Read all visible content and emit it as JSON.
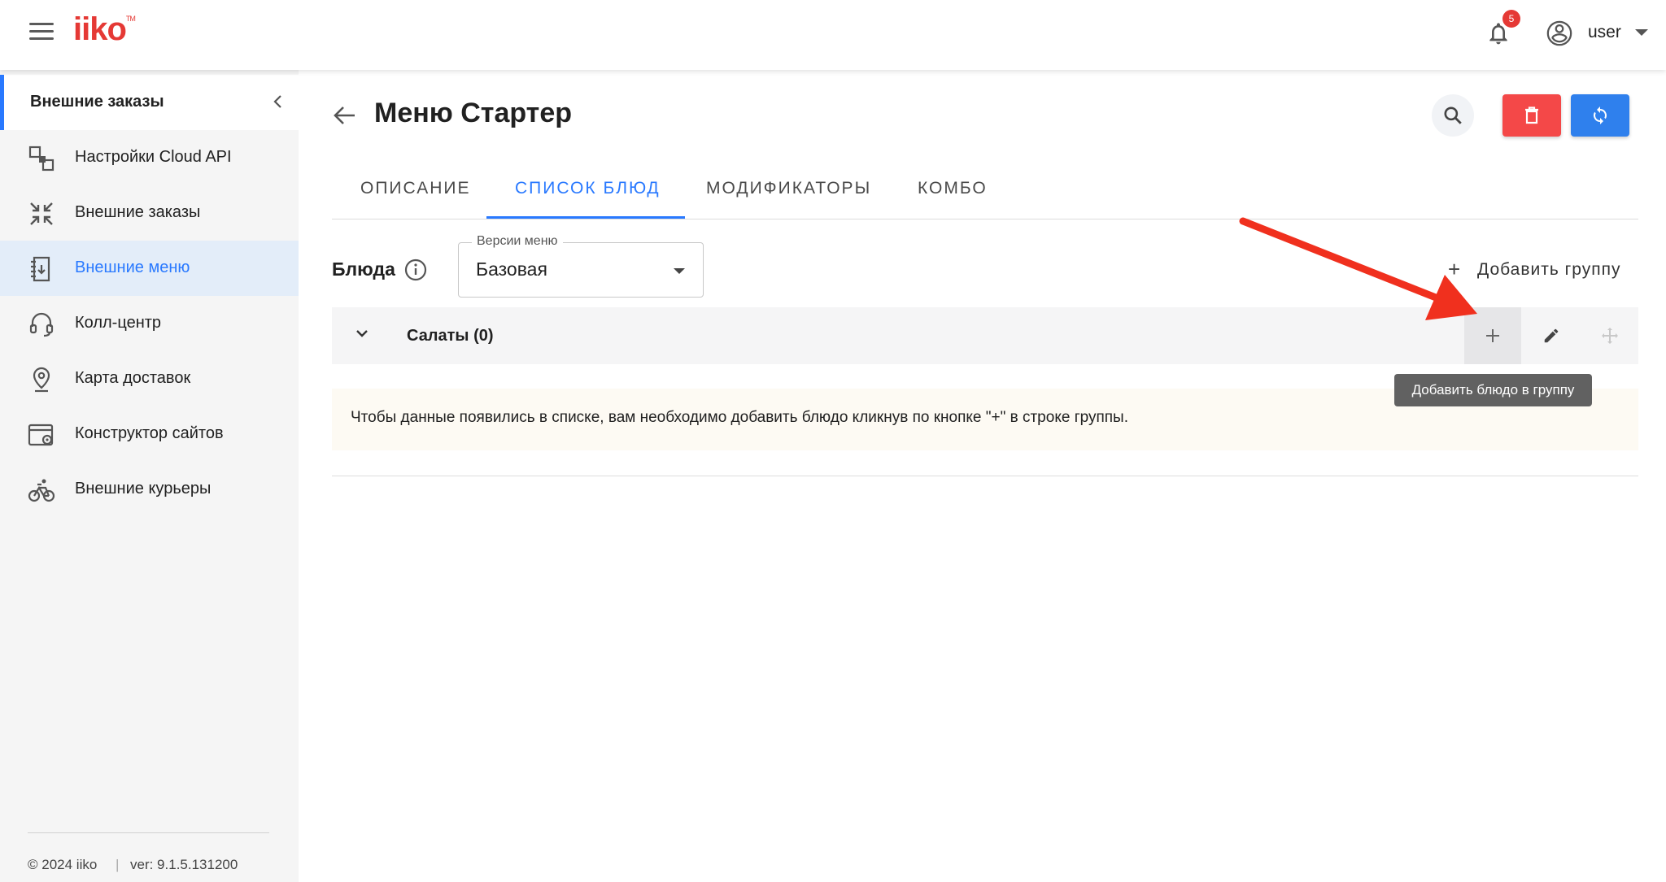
{
  "header": {
    "logo_text": "iiko",
    "logo_tm": "TM",
    "notifications_count": "5",
    "user_name": "user"
  },
  "sidebar": {
    "title": "Внешние заказы",
    "items": [
      {
        "label": "Настройки Cloud API",
        "icon": "cloud-settings-icon"
      },
      {
        "label": "Внешние заказы",
        "icon": "compress-icon"
      },
      {
        "label": "Внешние меню",
        "icon": "menu-book-icon",
        "active": true
      },
      {
        "label": "Колл-центр",
        "icon": "headset-icon"
      },
      {
        "label": "Карта доставок",
        "icon": "location-pin-icon"
      },
      {
        "label": "Конструктор сайтов",
        "icon": "site-builder-icon"
      },
      {
        "label": "Внешние курьеры",
        "icon": "bicycle-icon"
      }
    ],
    "footer_copyright": "© 2024 iiko",
    "footer_separator": "|",
    "footer_version": "ver: 9.1.5.131200"
  },
  "page": {
    "title": "Меню Стартер"
  },
  "tabs": [
    {
      "label": "ОПИСАНИЕ"
    },
    {
      "label": "СПИСОК БЛЮД",
      "active": true
    },
    {
      "label": "МОДИФИКАТОРЫ"
    },
    {
      "label": "КОМБО"
    }
  ],
  "dishes": {
    "label": "Блюда",
    "select_legend": "Версии меню",
    "select_value": "Базовая",
    "add_group_label": "Добавить группу",
    "add_group_symbol": "+"
  },
  "group": {
    "name": "Салаты (0)"
  },
  "tooltip": "Добавить блюдо в группу",
  "notice": "Чтобы данные появились в списке, вам необходимо добавить блюдо кликнув по кнопке \"+\" в строке группы.",
  "colors": {
    "accent": "#2979ff",
    "danger": "#f44848",
    "sync": "#2f80ed",
    "brand": "#e53935",
    "annotation_arrow": "#f0301e"
  }
}
